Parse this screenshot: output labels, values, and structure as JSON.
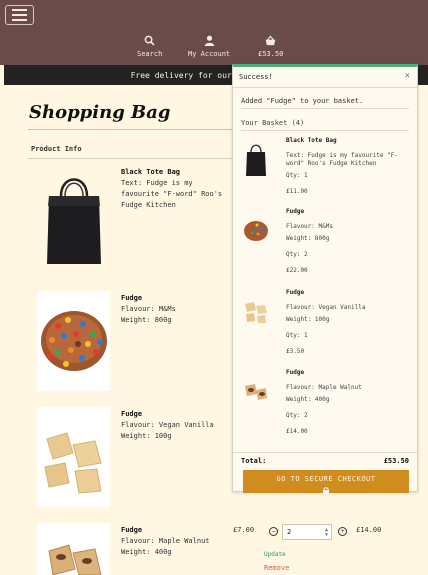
{
  "header": {
    "nav": [
      {
        "label": "Search",
        "icon": "search-icon"
      },
      {
        "label": "My Account",
        "icon": "user-icon"
      },
      {
        "label": "£53.50",
        "icon": "basket-icon"
      }
    ],
    "delivery_banner": "Free delivery for our s"
  },
  "page": {
    "title": "Shopping Bag",
    "column_product_info": "Product Info"
  },
  "products": [
    {
      "name": "Black Tote Bag",
      "detail": "Text: Fudge is my favourite \"F-word\" Roo's Fudge Kitchen",
      "image": "tote-bag"
    },
    {
      "name": "Fudge",
      "detail": "Flavour: M&Ms",
      "weight": "Weight: 800g",
      "image": "mm-fudge"
    },
    {
      "name": "Fudge",
      "detail": "Flavour: Vegan Vanilla",
      "weight": "Weight: 100g",
      "image": "vanilla-fudge"
    },
    {
      "name": "Fudge",
      "detail": "Flavour: Maple Walnut",
      "weight": "Weight: 400g",
      "image": "maple-fudge",
      "price": "£7.00",
      "qty": "2",
      "subtotal": "£14.00"
    }
  ],
  "row_actions": {
    "update": "Update",
    "remove": "Remove"
  },
  "toast": {
    "title": "Success!",
    "close": "×",
    "message": "Added \"Fudge\" to your basket.",
    "basket_heading": "Your Basket (4)",
    "items": [
      {
        "name": "Black Tote Bag",
        "desc": "Text: Fudge is my favourite \"F-word\" Roo's Fudge Kitchen",
        "weight": "",
        "qty": "Qty: 1",
        "price": "£11.00"
      },
      {
        "name": "Fudge",
        "desc": "Flavour: M&Ms",
        "weight": "Weight: 800g",
        "qty": "Qty: 2",
        "price": "£22.00"
      },
      {
        "name": "Fudge",
        "desc": "Flavour: Vegan Vanilla",
        "weight": "Weight: 100g",
        "qty": "Qty: 1",
        "price": "£3.50"
      },
      {
        "name": "Fudge",
        "desc": "Flavour: Maple Walnut",
        "weight": "Weight: 400g",
        "qty": "Qty: 2",
        "price": "£14.00"
      }
    ],
    "total_label": "Total:",
    "total_value": "£53.50",
    "checkout_label": "GO TO SECURE CHECKOUT"
  },
  "colors": {
    "header": "#6b4a4a",
    "page": "#fff7e1",
    "accent": "#d08c1c",
    "success": "#4caf7a"
  }
}
